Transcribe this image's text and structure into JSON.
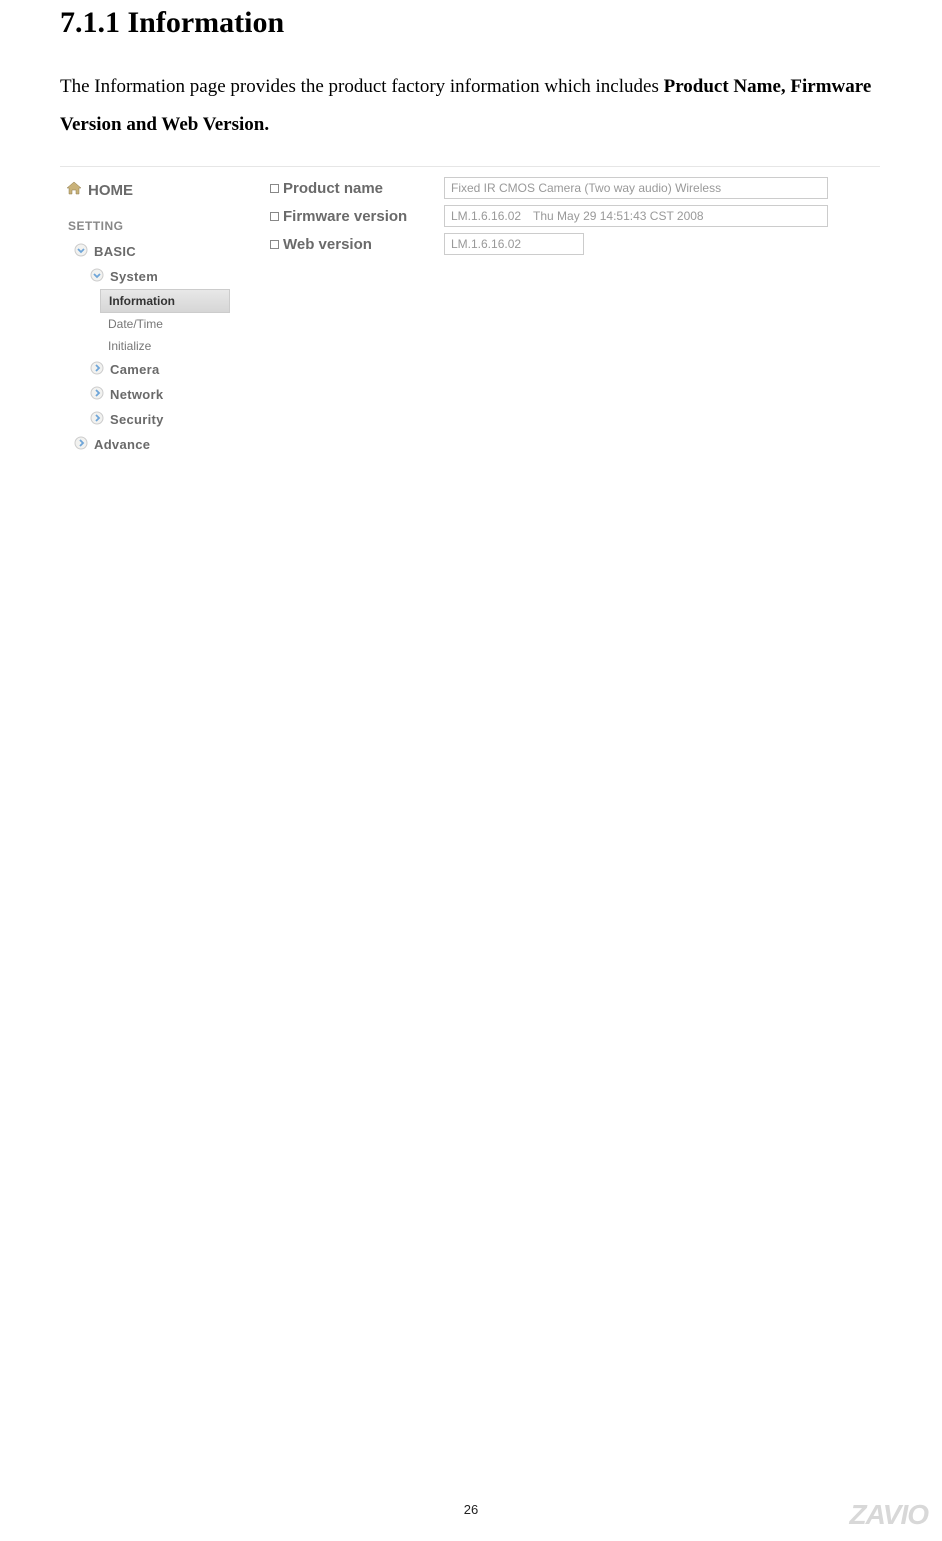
{
  "doc": {
    "heading": "7.1.1 Information",
    "para_plain": "The Information page provides the product factory information which includes ",
    "para_bold": "Product Name, Firmware Version and Web Version.",
    "page_number": "26",
    "brand": "ZAVIO"
  },
  "nav": {
    "home": "HOME",
    "setting": "SETTING",
    "basic": "BASIC",
    "system": "System",
    "information": "Information",
    "datetime": "Date/Time",
    "initialize": "Initialize",
    "camera": "Camera",
    "network": "Network",
    "security": "Security",
    "advance": "Advance"
  },
  "info": {
    "product_name_label": "Product name",
    "product_name_value": "Fixed IR CMOS Camera (Two way audio) Wireless",
    "firmware_label": "Firmware version",
    "firmware_value": "LM.1.6.16.02 Thu May 29 14:51:43 CST 2008",
    "web_label": "Web version",
    "web_value": "LM.1.6.16.02"
  }
}
